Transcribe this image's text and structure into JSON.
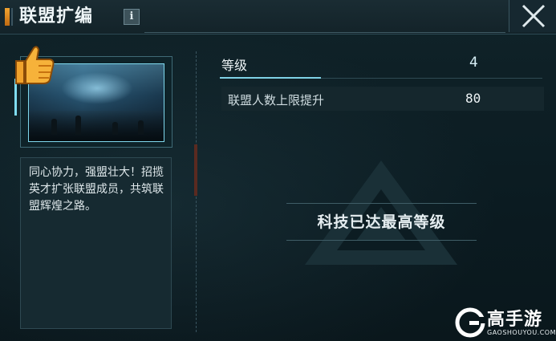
{
  "header": {
    "title": "联盟扩编",
    "info_icon_glyph": "i",
    "accent_color": "#f2a431"
  },
  "left_panel": {
    "thumbnail": "alliance-hangar-image",
    "description": "同心协力，强盟壮大！招揽英才扩张联盟成员，共筑联盟辉煌之路。"
  },
  "stats": {
    "level_label": "等级",
    "level_value": "4",
    "member_cap_label": "联盟人数上限提升",
    "member_cap_value": "80"
  },
  "status": {
    "maxed_text": "科技已达最高等级"
  },
  "watermark": {
    "name": "高手游",
    "url": "GAOSHOUYOU.COM"
  },
  "icons": {
    "close": "close-icon",
    "info": "info-icon",
    "thumb": "thumbs-up-icon",
    "emblem": "triangle-emblem-icon"
  }
}
